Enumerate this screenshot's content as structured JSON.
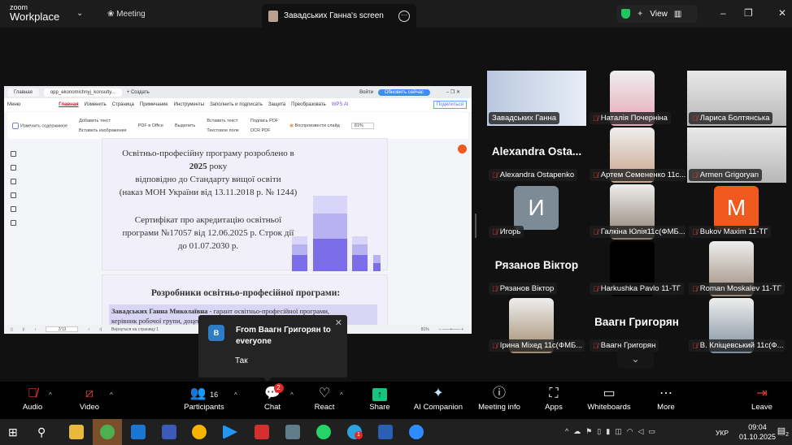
{
  "topbar": {
    "brand_small": "zoom",
    "brand_big": "Workplace",
    "meeting_label": "Meeting",
    "share_title": "Завадських Ганна's screen",
    "view_label": "View"
  },
  "pdf": {
    "tabs": [
      "Главная",
      "opp_ekonomichnyj_konsulty...",
      "Создать"
    ],
    "login": "Войти",
    "update": "Обновить сейчас",
    "menu": [
      "Меню",
      "Главная",
      "Изменить",
      "Страница",
      "Примечание",
      "Инструменты",
      "Заполнить и подписать",
      "Защита",
      "Преобразовать",
      "WPS AI",
      "Поделиться"
    ],
    "ribbon": [
      "Изменить содержимое",
      "Добавить текст",
      "Вставить изображение",
      "PDF в Office",
      "Выделить",
      "Вставить текст",
      "Текстовое поле",
      "Подпись PDF",
      "OCR PDF",
      "Воспроизвести слайд",
      "81%"
    ],
    "page1": [
      "Освітньо-професійну програму  розроблено в",
      "2025",
      "року",
      "відповідно  до Стандарту  вищої  освіти",
      "(наказ МОН України від 13.11.2018 р. № 1244)",
      "Сертифікат про акредитацію освітньої",
      "програми №17057 від 12.06.2025 р. Строк дії",
      "до  01.07.2030 р."
    ],
    "page2": {
      "heading": "Розробники освітньо-професійної програми:",
      "name": "Завадських Ганна Миколаївна",
      "line1": " - гарант          освітньо-професійної       програми,",
      "line2": "керівник робочої     групи,                          доцент"
    },
    "status": {
      "page": "2/13",
      "back": "Вернуться на страницу 1",
      "zoom": "81%"
    }
  },
  "chat_popup": {
    "avatar": "В",
    "from": "From Ваагн Григорян to everyone",
    "message": "Так"
  },
  "gallery": [
    {
      "name": "Завадських Ганна",
      "type": "video",
      "active": true
    },
    {
      "name": "Наталія Почерніна",
      "type": "video"
    },
    {
      "name": "Лариса Болтянська",
      "type": "video"
    },
    {
      "name": "Alexandra Ostapenko",
      "type": "name",
      "big": "Alexandra  Osta..."
    },
    {
      "name": "Артем Семененко 11с...",
      "type": "video"
    },
    {
      "name": "Armen Grigoryan",
      "type": "video"
    },
    {
      "name": "Игорь",
      "type": "letter",
      "letter": "И",
      "color": "#7d8b96"
    },
    {
      "name": "Галкіна Юлія11с(ФМБ...",
      "type": "video"
    },
    {
      "name": "Bukov Maxim 11-ТГ",
      "type": "letter",
      "letter": "M",
      "color": "#f05a1e"
    },
    {
      "name": "Рязанов Віктор",
      "type": "name",
      "big": "Рязанов Віктор"
    },
    {
      "name": "Harkushka Pavlo 11-ТГ",
      "type": "black"
    },
    {
      "name": "Roman Moskalev 11-ТГ",
      "type": "video"
    },
    {
      "name": "Ірина Міхед 11с(ФМБ...",
      "type": "video"
    },
    {
      "name": "Ваагн Григорян",
      "type": "name",
      "big": "Ваагн Григорян"
    },
    {
      "name": "В. Кліщевський 11с(Ф...",
      "type": "video"
    }
  ],
  "toolbar": {
    "audio": "Audio",
    "video": "Video",
    "participants": "Participants",
    "participants_count": "16",
    "chat": "Chat",
    "chat_badge": "2",
    "react": "React",
    "share": "Share",
    "ai": "AI Companion",
    "info": "Meeting info",
    "apps": "Apps",
    "whiteboards": "Whiteboards",
    "more": "More",
    "leave": "Leave"
  },
  "taskbar": {
    "lang": "УКР",
    "time": "09:04",
    "date": "01.10.2025",
    "notif": "2",
    "telegram_badge": "1"
  }
}
